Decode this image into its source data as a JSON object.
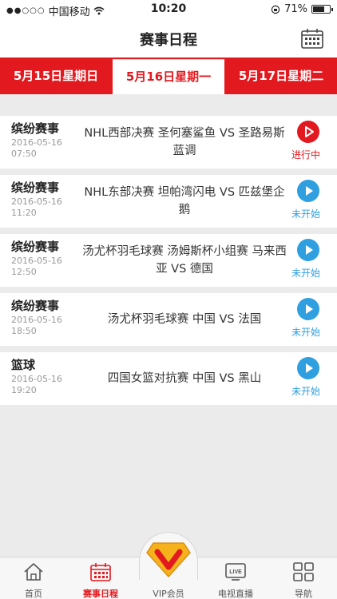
{
  "statusbar": {
    "signal_dots": "●●○○○",
    "carrier": "中国移动",
    "time": "10:20",
    "battery": "71%",
    "battery_level": 0.71
  },
  "nav": {
    "title": "赛事日程",
    "calendar_icon": "calendar-icon"
  },
  "dates": [
    {
      "label": "5月15日星期日",
      "active": false
    },
    {
      "label": "5月16日星期一",
      "active": true
    },
    {
      "label": "5月17日星期二",
      "active": false
    }
  ],
  "events": [
    {
      "category": "缤纷赛事",
      "date": "2016-05-16",
      "time": "07:50",
      "title": "NHL西部决赛 圣何塞鲨鱼 VS 圣路易斯蓝调",
      "status": "进行中",
      "status_color": "#e2191e"
    },
    {
      "category": "缤纷赛事",
      "date": "2016-05-16",
      "time": "11:20",
      "title": "NHL东部决赛 坦帕湾闪电 VS 匹兹堡企鹅",
      "status": "未开始",
      "status_color": "#2f9fe0"
    },
    {
      "category": "缤纷赛事",
      "date": "2016-05-16",
      "time": "12:50",
      "title": "汤尤杯羽毛球赛 汤姆斯杯小组赛 马来西亚 VS 德国",
      "status": "未开始",
      "status_color": "#2f9fe0"
    },
    {
      "category": "缤纷赛事",
      "date": "2016-05-16",
      "time": "18:50",
      "title": "汤尤杯羽毛球赛 中国 VS 法国",
      "status": "未开始",
      "status_color": "#2f9fe0"
    },
    {
      "category": "篮球",
      "date": "2016-05-16",
      "time": "19:20",
      "title": "四国女篮对抗赛 中国 VS 黑山",
      "status": "未开始",
      "status_color": "#2f9fe0"
    }
  ],
  "tabbar": {
    "home": "首页",
    "schedule": "赛事日程",
    "vip": "VIP会员",
    "tv": "电视直播",
    "tv_badge": "LIVE",
    "nav": "导航"
  },
  "colors": {
    "accent": "#e2191e",
    "info": "#2f9fe0",
    "vip_gold": "#f5b21a"
  }
}
